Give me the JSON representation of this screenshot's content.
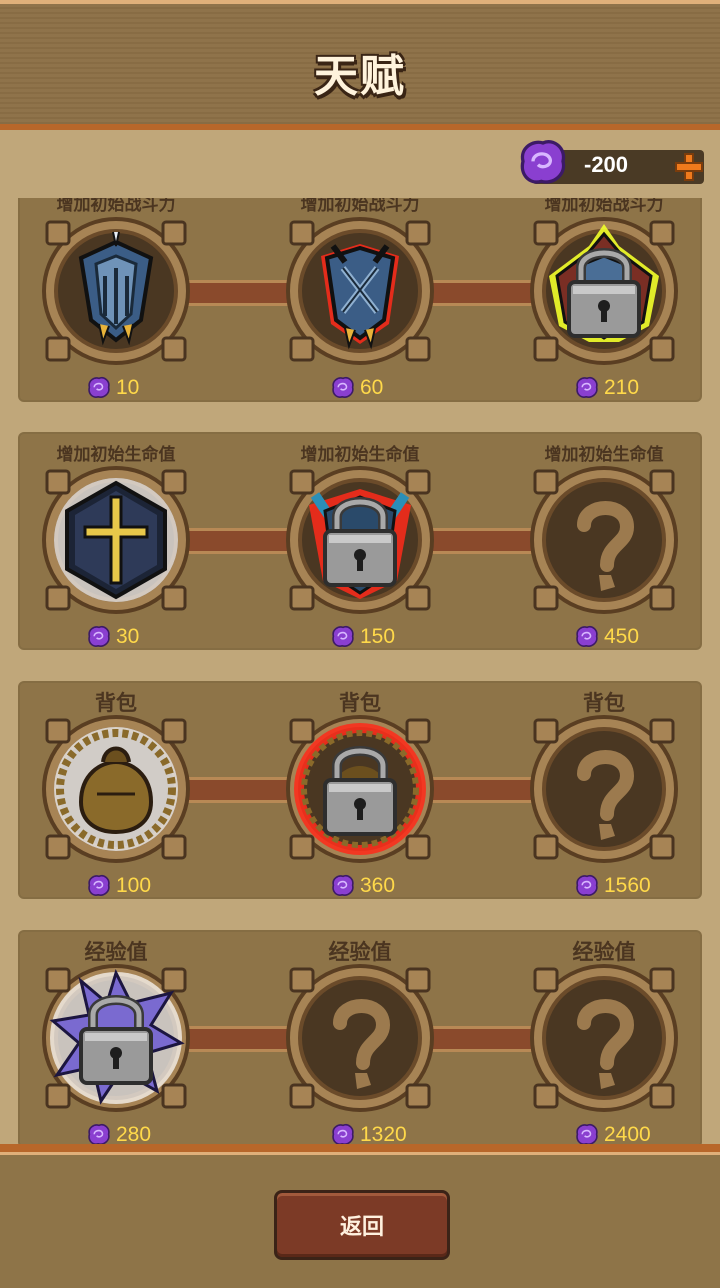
{
  "header": {
    "title": "天赋"
  },
  "currency": {
    "value": "-200",
    "gem_icon": "purple-gem-icon",
    "add_icon": "plus-icon"
  },
  "rows": [
    {
      "label": "增加初始战斗力",
      "costs": [
        "10",
        "60",
        "210"
      ]
    },
    {
      "label": "增加初始生命值",
      "costs": [
        "30",
        "150",
        "450"
      ]
    },
    {
      "label": "背包",
      "costs": [
        "100",
        "360",
        "1560"
      ]
    },
    {
      "label": "经验值",
      "costs": [
        "280",
        "1320",
        "2400"
      ]
    }
  ],
  "footer": {
    "back_label": "返回"
  },
  "colors": {
    "accent": "#b8672a",
    "cost": "#ffd94a",
    "gem": "#8a3fd0",
    "lock_glow_red": "#ff2a1a",
    "lock_glow_yellow": "#f2ff2a"
  }
}
